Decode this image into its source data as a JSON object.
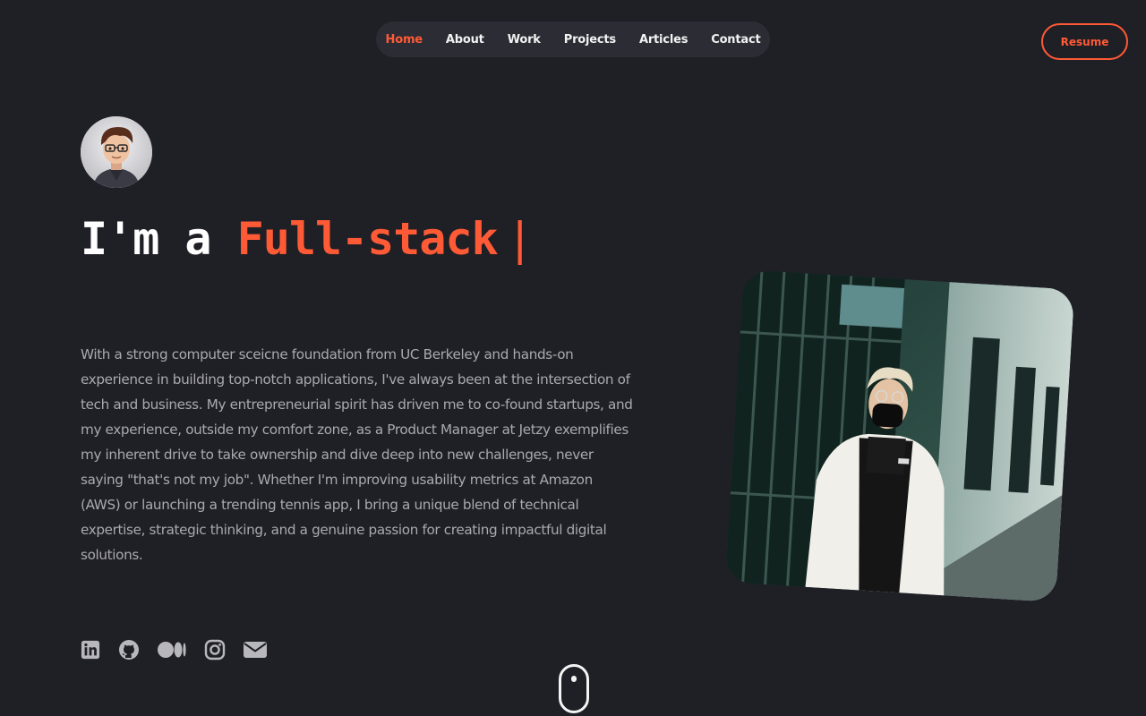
{
  "nav": {
    "items": [
      {
        "label": "Home",
        "active": true
      },
      {
        "label": "About",
        "active": false
      },
      {
        "label": "Work",
        "active": false
      },
      {
        "label": "Projects",
        "active": false
      },
      {
        "label": "Articles",
        "active": false
      },
      {
        "label": "Contact",
        "active": false
      }
    ]
  },
  "header": {
    "resume_label": "Resume"
  },
  "hero": {
    "headline_prefix": "I'm a ",
    "headline_accent": "Full-stack",
    "caret": "|",
    "bio": "With a strong computer sceicne foundation from UC Berkeley and hands-on experience in building top-notch applications, I've always been at the intersection of tech and business. My entrepreneurial spirit has driven me to co-found startups, and my experience, outside my comfort zone, as a Product Manager at Jetzy exemplifies my inherent drive to take ownership and dive deep into new challenges, never saying \"that's not my job\". Whether I'm improving usability metrics at Amazon (AWS) or launching a trending tennis app, I bring a unique blend of technical expertise, strategic thinking, and a genuine passion for creating impactful digital solutions."
  },
  "social": {
    "icons": [
      "linkedin-icon",
      "github-icon",
      "medium-icon",
      "instagram-icon",
      "mail-icon"
    ]
  },
  "colors": {
    "background": "#1f1f26",
    "accent": "#ff5a36",
    "nav_bg": "#2b2c34",
    "body_text": "#a9a9ae"
  }
}
